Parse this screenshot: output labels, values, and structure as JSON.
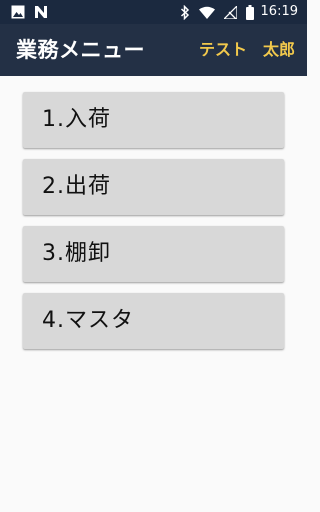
{
  "status_bar": {
    "time": "16:19",
    "icons": [
      "image-icon",
      "n-icon",
      "bluetooth-icon",
      "wifi-icon",
      "signal-off-icon",
      "battery-icon"
    ]
  },
  "app_bar": {
    "title": "業務メニュー",
    "user_first": "テスト",
    "user_last": "太郎"
  },
  "menu": {
    "items": [
      {
        "label": "1.入荷"
      },
      {
        "label": "2.出荷"
      },
      {
        "label": "3.棚卸"
      },
      {
        "label": "4.マスタ"
      }
    ]
  },
  "colors": {
    "status_bar_bg": "#1b293f",
    "app_bar_bg": "#233045",
    "title_text": "#ffffff",
    "user_text": "#f2c94c",
    "button_bg": "#d8d8d8",
    "page_bg": "#fafafa"
  }
}
